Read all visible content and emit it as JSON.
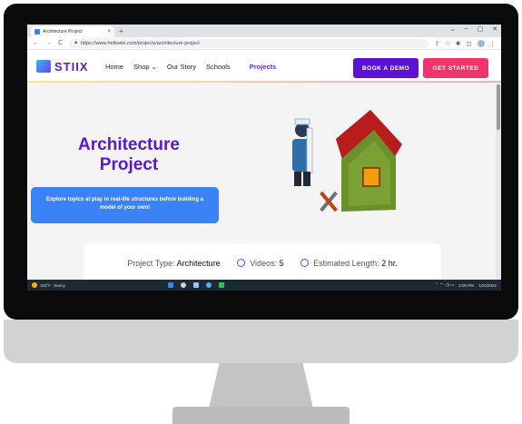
{
  "browser": {
    "tab_title": "Architecture Project",
    "tab_close": "×",
    "new_tab": "+",
    "window_controls": [
      "⌄",
      "–",
      "▢",
      "✕"
    ],
    "nav_icons": [
      "←",
      "→",
      "C"
    ],
    "url": "https://www.hellostix.com/projects/architecture-project",
    "right_icons": [
      "⇪",
      "☆",
      "✱",
      "◫",
      "⋮"
    ]
  },
  "site": {
    "logo_text": "STIIX",
    "nav": [
      "Home",
      "Shop ⌄",
      "Our Story",
      "Schools",
      "Projects"
    ],
    "book_demo": "BOOK A DEMO",
    "get_started": "GET STARTED"
  },
  "hero": {
    "title_line1": "Architecture",
    "title_line2": "Project",
    "description": "Explore topics at play in real-life structures before building a model of your own!"
  },
  "project_info": {
    "type_label": "Project Type:",
    "type_value": "Architecture",
    "videos_label": "Videos:",
    "videos_value": "5",
    "length_label": "Estimated Length:",
    "length_value": "2 hr."
  },
  "taskbar": {
    "temp": "103°F",
    "condition": "Sunny",
    "tray_icons": "⌃ ⌔ ◁) ▭",
    "time": "2:09 PM",
    "date": "1/10/2022"
  },
  "colors": {
    "brand_purple": "#5b17c9",
    "demo_button": "#5b12d6",
    "start_button": "#f0346a",
    "info_pill": "#3b82f6"
  }
}
